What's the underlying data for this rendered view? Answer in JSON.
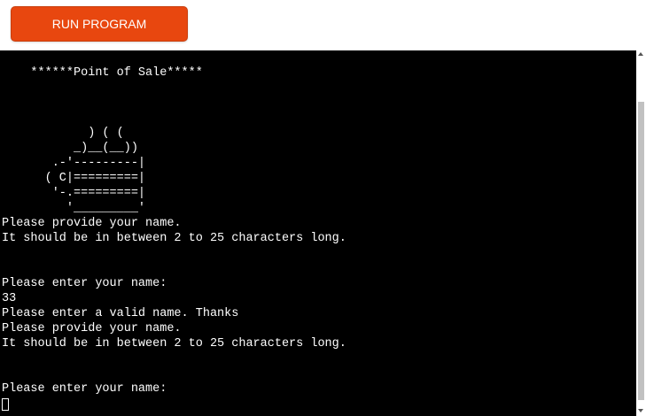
{
  "run_button": {
    "label": "RUN PROGRAM"
  },
  "terminal": {
    "lines": [
      "",
      "    ******Point of Sale*****",
      "",
      "",
      "",
      "            ) ( (",
      "          _)__(__))",
      "       .-'---------|",
      "      ( C|=========|",
      "       '-.=========|",
      "         '_________'",
      "Please provide your name.",
      "It should be in between 2 to 25 characters long.",
      "",
      "",
      "Please enter your name:",
      "33",
      "Please enter a valid name. Thanks",
      "Please provide your name.",
      "It should be in between 2 to 25 characters long.",
      "",
      "",
      "Please enter your name:"
    ]
  },
  "colors": {
    "button_bg": "#e8470f",
    "terminal_bg": "#000000",
    "terminal_fg": "#ffffff"
  }
}
